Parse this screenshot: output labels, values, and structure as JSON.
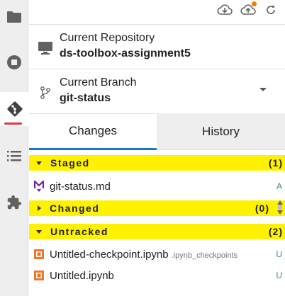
{
  "activity_bar": {
    "items": [
      {
        "icon": "folder-icon"
      },
      {
        "icon": "stop-circle-icon"
      },
      {
        "icon": "git-icon",
        "active": true
      },
      {
        "icon": "list-icon"
      },
      {
        "icon": "extension-puzzle-icon"
      }
    ]
  },
  "toolbar": {
    "pull_icon": "cloud-download-icon",
    "push_icon": "cloud-upload-icon",
    "refresh_icon": "refresh-icon",
    "badge_color": "#f57c00"
  },
  "repository": {
    "title": "Current Repository",
    "value": "ds-toolbox-assignment5"
  },
  "branch": {
    "title": "Current Branch",
    "value": "git-status"
  },
  "tabs": {
    "changes": "Changes",
    "history": "History"
  },
  "staged": {
    "label": "Staged",
    "count": "(1)",
    "files": [
      {
        "name": "git-status.md",
        "status": "A"
      }
    ]
  },
  "changed": {
    "label": "Changed",
    "count": "(0)"
  },
  "untracked": {
    "label": "Untracked",
    "count": "(2)",
    "files": [
      {
        "name": "Untitled-checkpoint.ipynb",
        "path": ".ipynb_checkpoints",
        "status": "U"
      },
      {
        "name": "Untitled.ipynb",
        "path": "",
        "status": "U"
      }
    ]
  },
  "colors": {
    "highlight": "#fff200",
    "accent": "#1976d2",
    "active_marker": "#e53935",
    "status": "#3d8a7a",
    "notebook_icon": "#f37626",
    "markdown_icon": "#7b1fa2"
  }
}
